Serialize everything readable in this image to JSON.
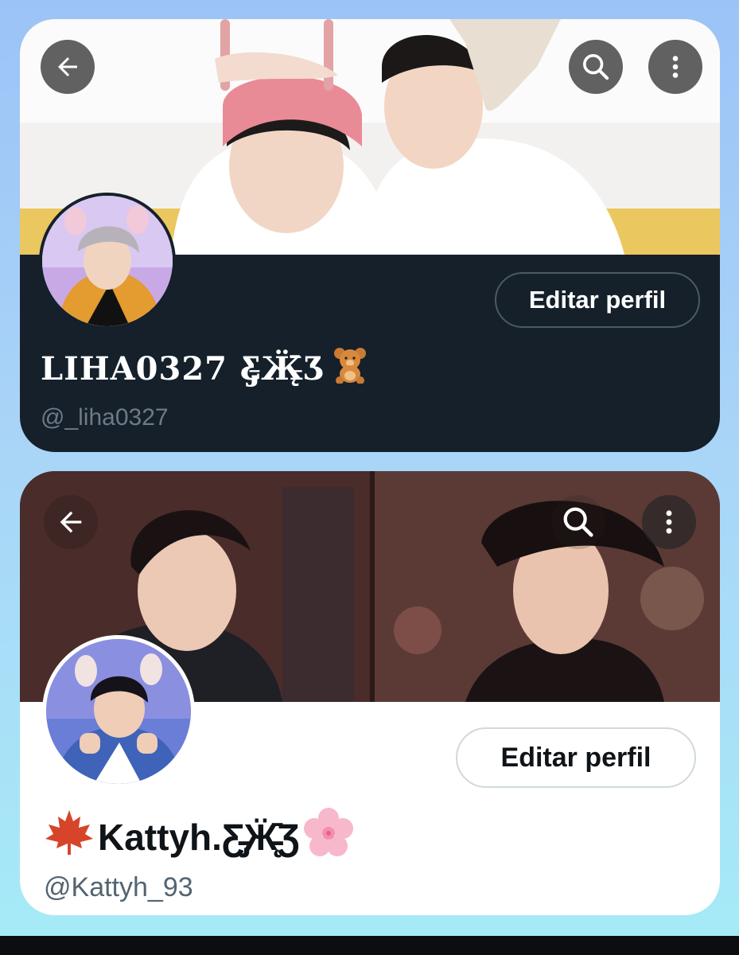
{
  "profiles": [
    {
      "display_name": "LIHA0327 Ƹ̵̡Ӝ̵̨̄Ʒ",
      "display_emoji": "teddy-bear",
      "handle": "@_liha0327",
      "edit_label": "Editar perfil",
      "theme": "dark",
      "colors": {
        "background": "#15202b",
        "name": "#ffffff",
        "handle": "#6e7b87"
      },
      "icons": {
        "back": "arrow-left-icon",
        "search": "search-icon",
        "more": "more-vertical-icon"
      }
    },
    {
      "display_name": "Kattyh.Ƹ̵̡Ӝ̵̨̄Ʒ",
      "display_emoji_left": "maple-leaf",
      "display_emoji_right": "cherry-blossom",
      "handle": "@Kattyh_93",
      "edit_label": "Editar perfil",
      "theme": "light",
      "colors": {
        "background": "#ffffff",
        "name": "#0f1419",
        "handle": "#536471"
      },
      "icons": {
        "back": "arrow-left-icon",
        "search": "search-icon",
        "more": "more-vertical-icon"
      }
    }
  ]
}
